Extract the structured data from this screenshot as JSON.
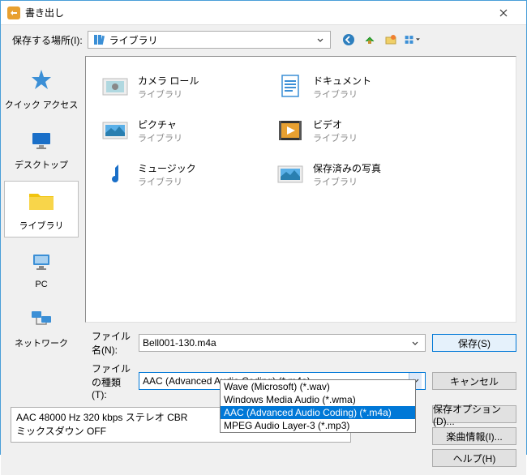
{
  "window": {
    "title": "書き出し"
  },
  "toolbar": {
    "location_label": "保存する場所(I):",
    "location_value": "ライブラリ"
  },
  "sidebar": {
    "items": [
      {
        "label": "クイック アクセス"
      },
      {
        "label": "デスクトップ"
      },
      {
        "label": "ライブラリ"
      },
      {
        "label": "PC"
      },
      {
        "label": "ネットワーク"
      }
    ]
  },
  "content": {
    "items": [
      {
        "name": "カメラ ロール",
        "type": "ライブラリ"
      },
      {
        "name": "ドキュメント",
        "type": "ライブラリ"
      },
      {
        "name": "ピクチャ",
        "type": "ライブラリ"
      },
      {
        "name": "ビデオ",
        "type": "ライブラリ"
      },
      {
        "name": "ミュージック",
        "type": "ライブラリ"
      },
      {
        "name": "保存済みの写真",
        "type": "ライブラリ"
      }
    ]
  },
  "fields": {
    "filename_label": "ファイル名(N):",
    "filename_value": "Bell001-130.m4a",
    "filetype_label": "ファイルの種類(T):",
    "filetype_value": "AAC (Advanced Audio Coding) (*.m4a)",
    "filetype_options": [
      "Wave (Microsoft) (*.wav)",
      "Windows Media Audio (*.wma)",
      "AAC (Advanced Audio Coding) (*.m4a)",
      "MPEG Audio Layer-3 (*.mp3)"
    ]
  },
  "info": {
    "line1": "AAC 48000 Hz 320 kbps ステレオ CBR",
    "line2": "ミックスダウン OFF"
  },
  "buttons": {
    "save": "保存(S)",
    "cancel": "キャンセル",
    "save_options": "保存オプション(D)...",
    "song_info": "楽曲情報(I)...",
    "help": "ヘルプ(H)"
  }
}
